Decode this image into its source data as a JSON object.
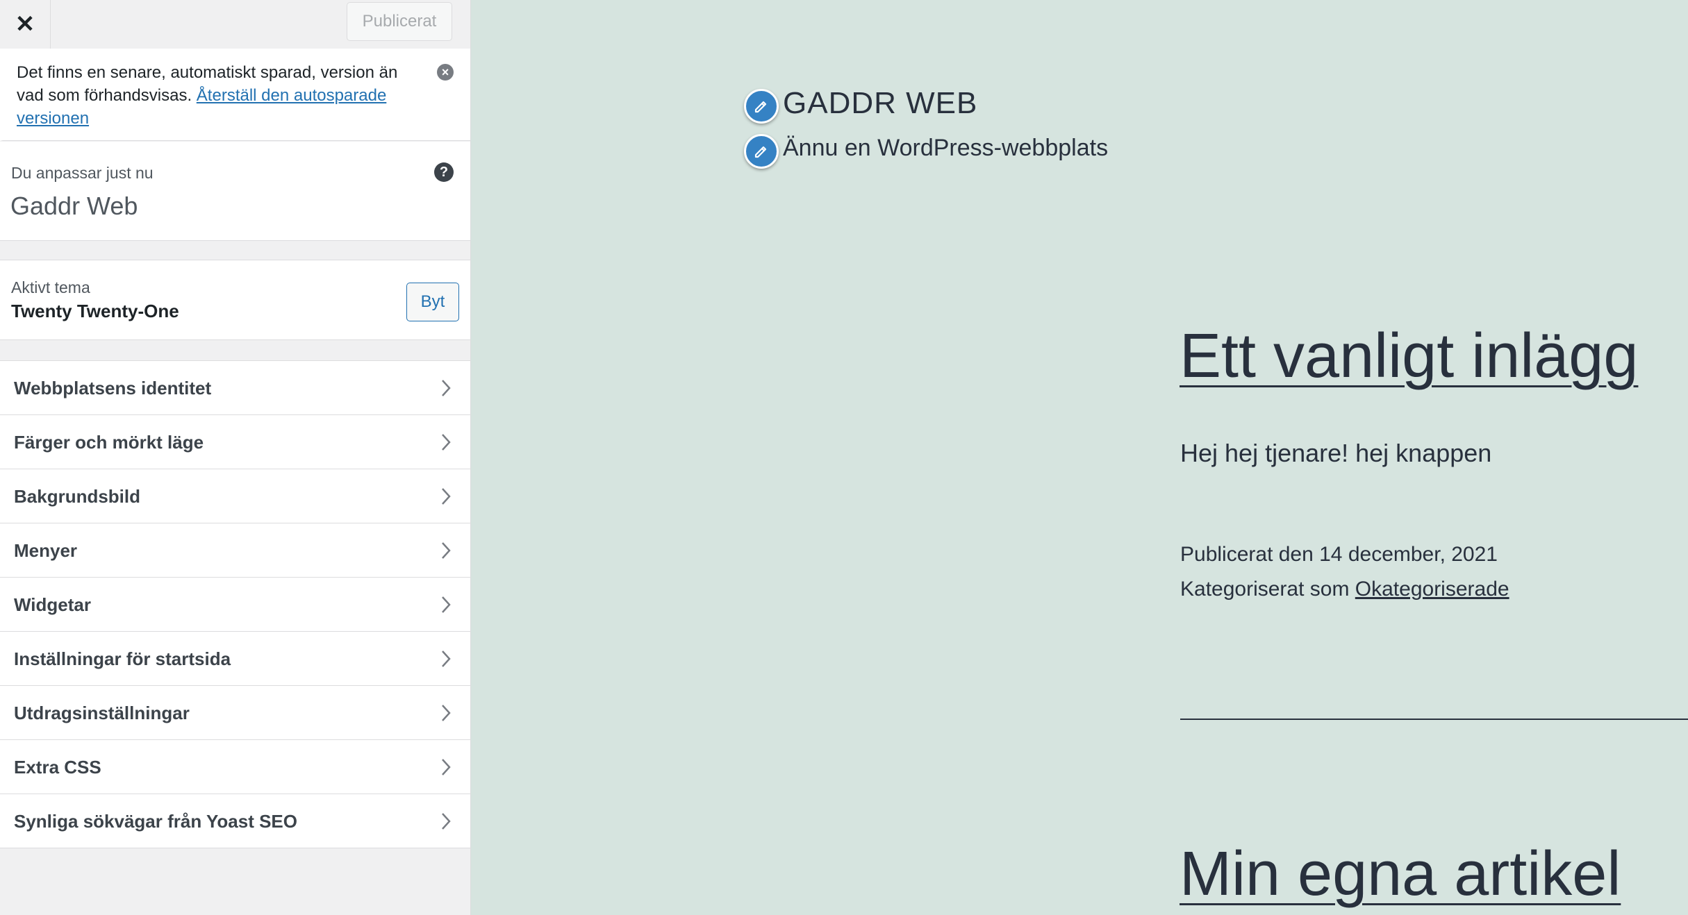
{
  "header": {
    "close_glyph": "✕",
    "publish_label": "Publicerat"
  },
  "notice": {
    "text": "Det finns en senare, automatiskt sparad, version än vad som förhandsvisas. ",
    "link": "Återställ den autosparade versionen",
    "dismiss_glyph": "×"
  },
  "customizing": {
    "label": "Du anpassar just nu",
    "title": "Gaddr Web",
    "help_glyph": "?"
  },
  "theme": {
    "label": "Aktivt tema",
    "name": "Twenty Twenty-One",
    "change_label": "Byt"
  },
  "panels": [
    {
      "label": "Webbplatsens identitet"
    },
    {
      "label": "Färger och mörkt läge"
    },
    {
      "label": "Bakgrundsbild"
    },
    {
      "label": "Menyer"
    },
    {
      "label": "Widgetar"
    },
    {
      "label": "Inställningar för startsida"
    },
    {
      "label": "Utdragsinställningar"
    },
    {
      "label": "Extra CSS"
    },
    {
      "label": "Synliga sökvägar från Yoast SEO"
    }
  ],
  "preview": {
    "site_title": "GADDR WEB",
    "site_tagline": "Ännu en WordPress-webbplats",
    "posts": [
      {
        "title": "Ett vanligt inlägg",
        "excerpt": "Hej hej tjenare! hej knappen",
        "date": "Publicerat den 14 december, 2021",
        "category_prefix": "Kategoriserat som ",
        "category": "Okategoriserade"
      },
      {
        "title": "Min egna artikel"
      }
    ]
  },
  "colors": {
    "accent": "#2271b1",
    "preview_bg": "#d6e4df",
    "edit_shortcut": "#3582c4",
    "text_dark": "#28303d"
  },
  "icons": {
    "close": "close-icon",
    "dismiss": "dismiss-icon",
    "help": "help-icon",
    "chevron": "chevron-right-icon",
    "edit": "pencil-icon"
  }
}
